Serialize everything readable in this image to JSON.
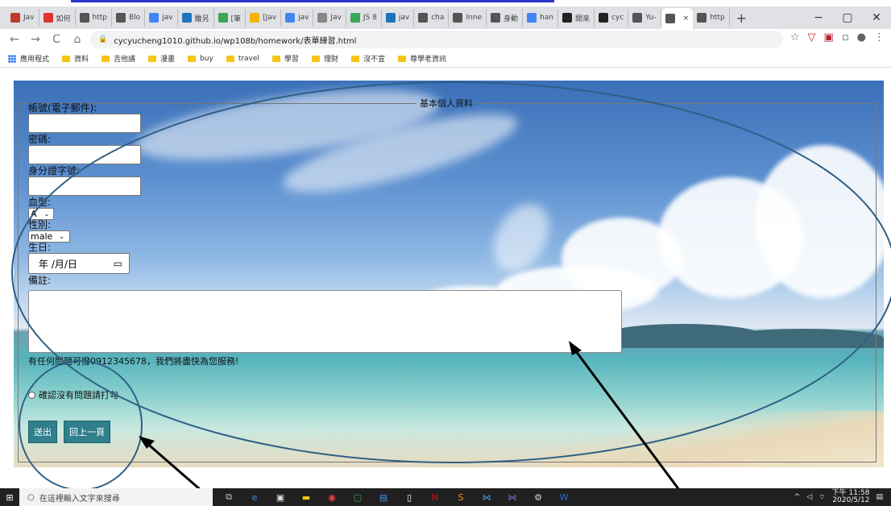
{
  "browser": {
    "tabs": [
      {
        "label": "Jav",
        "color": "#c0392b"
      },
      {
        "label": "如何",
        "color": "#d33"
      },
      {
        "label": "http",
        "color": "#555"
      },
      {
        "label": "Blo",
        "color": "#555"
      },
      {
        "label": "jav",
        "color": "#4285f4"
      },
      {
        "label": "雖另",
        "color": "#1e73be"
      },
      {
        "label": "[筆",
        "color": "#3aa757"
      },
      {
        "label": "[Jav",
        "color": "#f5b400"
      },
      {
        "label": "jav",
        "color": "#4285f4"
      },
      {
        "label": "Jav",
        "color": "#888"
      },
      {
        "label": "JS 8",
        "color": "#3aa757"
      },
      {
        "label": "jav",
        "color": "#1e73be"
      },
      {
        "label": "cha",
        "color": "#555"
      },
      {
        "label": "Inne",
        "color": "#555"
      },
      {
        "label": "身動",
        "color": "#555"
      },
      {
        "label": "han",
        "color": "#4285f4"
      },
      {
        "label": "開來",
        "color": "#222"
      },
      {
        "label": "cyc",
        "color": "#222"
      },
      {
        "label": "Yu-",
        "color": "#555"
      },
      {
        "label": "",
        "color": "#555",
        "active": true
      },
      {
        "label": "http",
        "color": "#555"
      }
    ],
    "new_tab": "+",
    "url": "cycyucheng1010.github.io/wp108b/homework/表單練習.html",
    "bookmarks": [
      {
        "label": "應用程式",
        "icon": "apps"
      },
      {
        "label": "資料"
      },
      {
        "label": "吉他譜"
      },
      {
        "label": "漫畫"
      },
      {
        "label": "buy"
      },
      {
        "label": "travel"
      },
      {
        "label": "學習"
      },
      {
        "label": "理財"
      },
      {
        "label": "沒不宣"
      },
      {
        "label": "尊學老資訊"
      }
    ]
  },
  "form": {
    "legend": "基本個人資料",
    "account_label": "帳號(電子郵件):",
    "password_label": "密碼:",
    "id_label": "身分證字號:",
    "blood_label": "血型:",
    "blood_value": "A",
    "gender_label": "性別:",
    "gender_value": "male",
    "birthday_label": "生日:",
    "birthday_placeholder": "年 /月/日",
    "remark_label": "備註:",
    "contact_text": "有任何問題可撥0912345678，我們將盡快為您服務!",
    "confirm_label": "確認沒有問題請打勾",
    "submit_label": "送出",
    "back_label": "回上一頁"
  },
  "taskbar": {
    "search_placeholder": "在這裡輸入文字來搜尋",
    "time": "下午 11:58",
    "date": "2020/5/12"
  }
}
